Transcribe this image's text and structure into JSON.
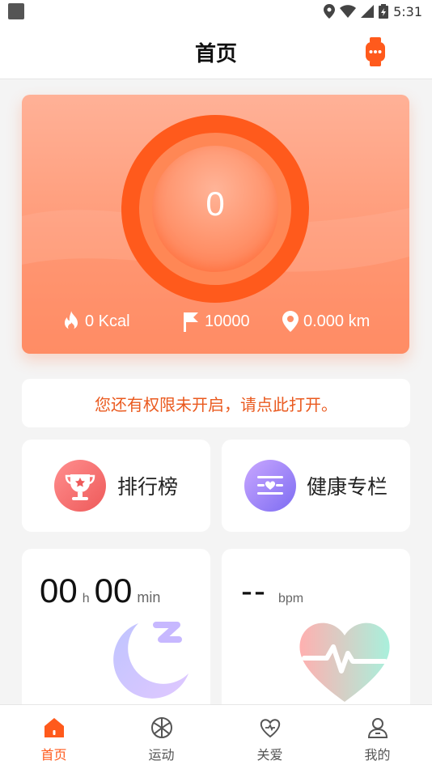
{
  "status_bar": {
    "time": "5:31"
  },
  "header": {
    "title": "首页"
  },
  "hero": {
    "steps": "0",
    "kcal": "0 Kcal",
    "goal": "10000",
    "distance": "0.000 km"
  },
  "permission_notice": "您还有权限未开启，请点此打开。",
  "quick": {
    "ranking_label": "排行榜",
    "health_label": "健康专栏"
  },
  "sleep": {
    "hours": "00",
    "hours_unit": "h",
    "minutes": "00",
    "minutes_unit": "min"
  },
  "heart_rate": {
    "value": "--",
    "unit": "bpm"
  },
  "nav": {
    "items": [
      {
        "label": "首页",
        "icon": "home-icon",
        "active": true
      },
      {
        "label": "运动",
        "icon": "basketball-icon",
        "active": false
      },
      {
        "label": "关爱",
        "icon": "heart-care-icon",
        "active": false
      },
      {
        "label": "我的",
        "icon": "user-icon",
        "active": false
      }
    ]
  },
  "colors": {
    "accent": "#ff5a1c",
    "notice_text": "#ea5a1f",
    "hero_bg": "#ff9c7a"
  }
}
